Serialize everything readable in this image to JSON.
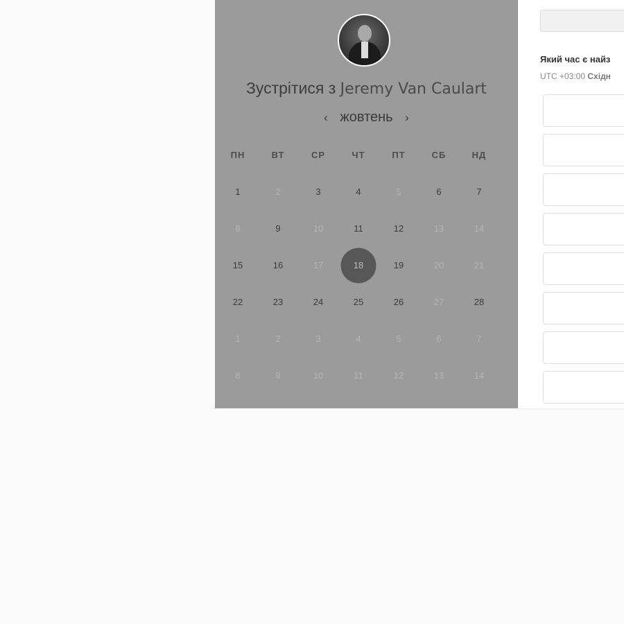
{
  "host": {
    "title_prefix": "Зустрітися з",
    "name": "Jeremy Van Caulart",
    "avatar_icon": "person-photo-icon"
  },
  "calendar": {
    "month": "жовтень",
    "prev_label": "‹",
    "next_label": "›",
    "weekdays": [
      "ПН",
      "ВТ",
      "СР",
      "ЧТ",
      "ПТ",
      "СБ",
      "НД"
    ],
    "weeks": [
      [
        {
          "d": "1",
          "on": true
        },
        {
          "d": "2",
          "on": false
        },
        {
          "d": "3",
          "on": true
        },
        {
          "d": "4",
          "on": true
        },
        {
          "d": "5",
          "on": false
        },
        {
          "d": "6",
          "on": true
        },
        {
          "d": "7",
          "on": true
        }
      ],
      [
        {
          "d": "8",
          "on": false
        },
        {
          "d": "9",
          "on": true
        },
        {
          "d": "10",
          "on": false
        },
        {
          "d": "11",
          "on": true
        },
        {
          "d": "12",
          "on": true
        },
        {
          "d": "13",
          "on": false
        },
        {
          "d": "14",
          "on": false
        }
      ],
      [
        {
          "d": "15",
          "on": true
        },
        {
          "d": "16",
          "on": true
        },
        {
          "d": "17",
          "on": false
        },
        {
          "d": "18",
          "on": true,
          "selected": true
        },
        {
          "d": "19",
          "on": true
        },
        {
          "d": "20",
          "on": false
        },
        {
          "d": "21",
          "on": false
        }
      ],
      [
        {
          "d": "22",
          "on": true
        },
        {
          "d": "23",
          "on": true
        },
        {
          "d": "24",
          "on": true
        },
        {
          "d": "25",
          "on": true
        },
        {
          "d": "26",
          "on": true
        },
        {
          "d": "27",
          "on": false
        },
        {
          "d": "28",
          "on": true
        }
      ],
      [
        {
          "d": "1",
          "on": false
        },
        {
          "d": "2",
          "on": false
        },
        {
          "d": "3",
          "on": false
        },
        {
          "d": "4",
          "on": false
        },
        {
          "d": "5",
          "on": false
        },
        {
          "d": "6",
          "on": false
        },
        {
          "d": "7",
          "on": false
        }
      ],
      [
        {
          "d": "8",
          "on": false
        },
        {
          "d": "9",
          "on": false
        },
        {
          "d": "10",
          "on": false
        },
        {
          "d": "11",
          "on": false
        },
        {
          "d": "12",
          "on": false
        },
        {
          "d": "13",
          "on": false
        },
        {
          "d": "14",
          "on": false
        }
      ]
    ]
  },
  "times": {
    "question": "Який час є найз",
    "tz_offset": "UTC +03:00",
    "tz_name": "Східн",
    "slots": [
      "",
      "",
      "",
      "",
      "",
      "",
      "",
      ""
    ]
  },
  "colors": {
    "left_panel": "#9b9b9b",
    "selected_day": "#575757",
    "page_bg": "#fbfbfb"
  }
}
